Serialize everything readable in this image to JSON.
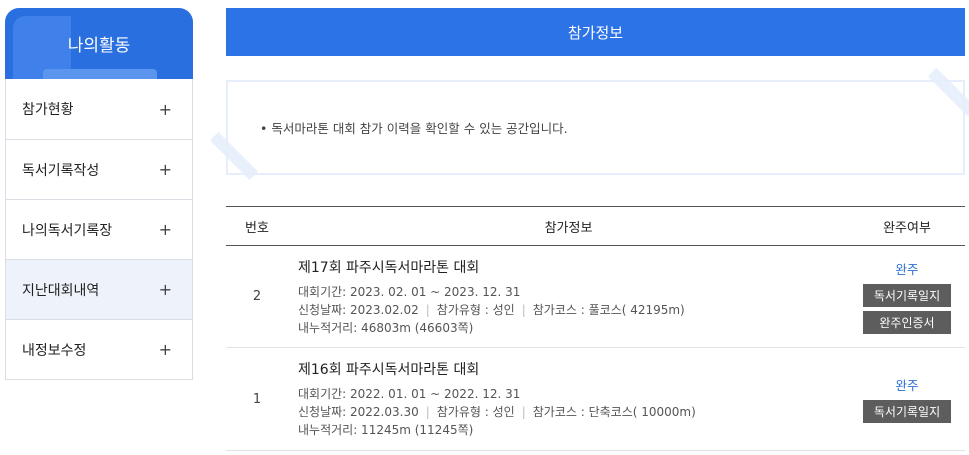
{
  "sidebar": {
    "title": "나의활동",
    "items": [
      {
        "label": "참가현황",
        "icon": "+"
      },
      {
        "label": "독서기록작성",
        "icon": "+"
      },
      {
        "label": "나의독서기록장",
        "icon": "+"
      },
      {
        "label": "지난대회내역",
        "icon": "+"
      },
      {
        "label": "내정보수정",
        "icon": "+"
      }
    ],
    "active_index": 3
  },
  "header": {
    "title": "참가정보"
  },
  "info": {
    "text": "• 독서마라톤 대회 참가 이력을 확인할 수 있는 공간입니다."
  },
  "table": {
    "headers": {
      "no": "번호",
      "info": "참가정보",
      "done": "완주여부"
    },
    "rows": [
      {
        "no": "2",
        "title": "제17회 파주시독서마라톤 대회",
        "period": "대회기간: 2023. 02. 01 ~ 2023. 12. 31",
        "apply_date": "신청날짜: 2023.02.02",
        "type": "참가유형 : 성인",
        "course": "참가코스 : 풀코스( 42195m)",
        "distance": "내누적거리: 46803m (46603쪽)",
        "status": "완주",
        "btn_record": "독서기록일지",
        "btn_cert": "완주인증서"
      },
      {
        "no": "1",
        "title": "제16회 파주시독서마라톤 대회",
        "period": "대회기간: 2022. 01. 01 ~ 2022. 12. 31",
        "apply_date": "신청날짜: 2022.03.30",
        "type": "참가유형 : 성인",
        "course": "참가코스 : 단축코스( 10000m)",
        "distance": "내누적거리: 11245m (11245쪽)",
        "status": "완주",
        "btn_record": "독서기록일지"
      }
    ]
  },
  "colors": {
    "accent": "#2b73e6",
    "button": "#5d5d5d",
    "status": "#2b6fd1"
  }
}
